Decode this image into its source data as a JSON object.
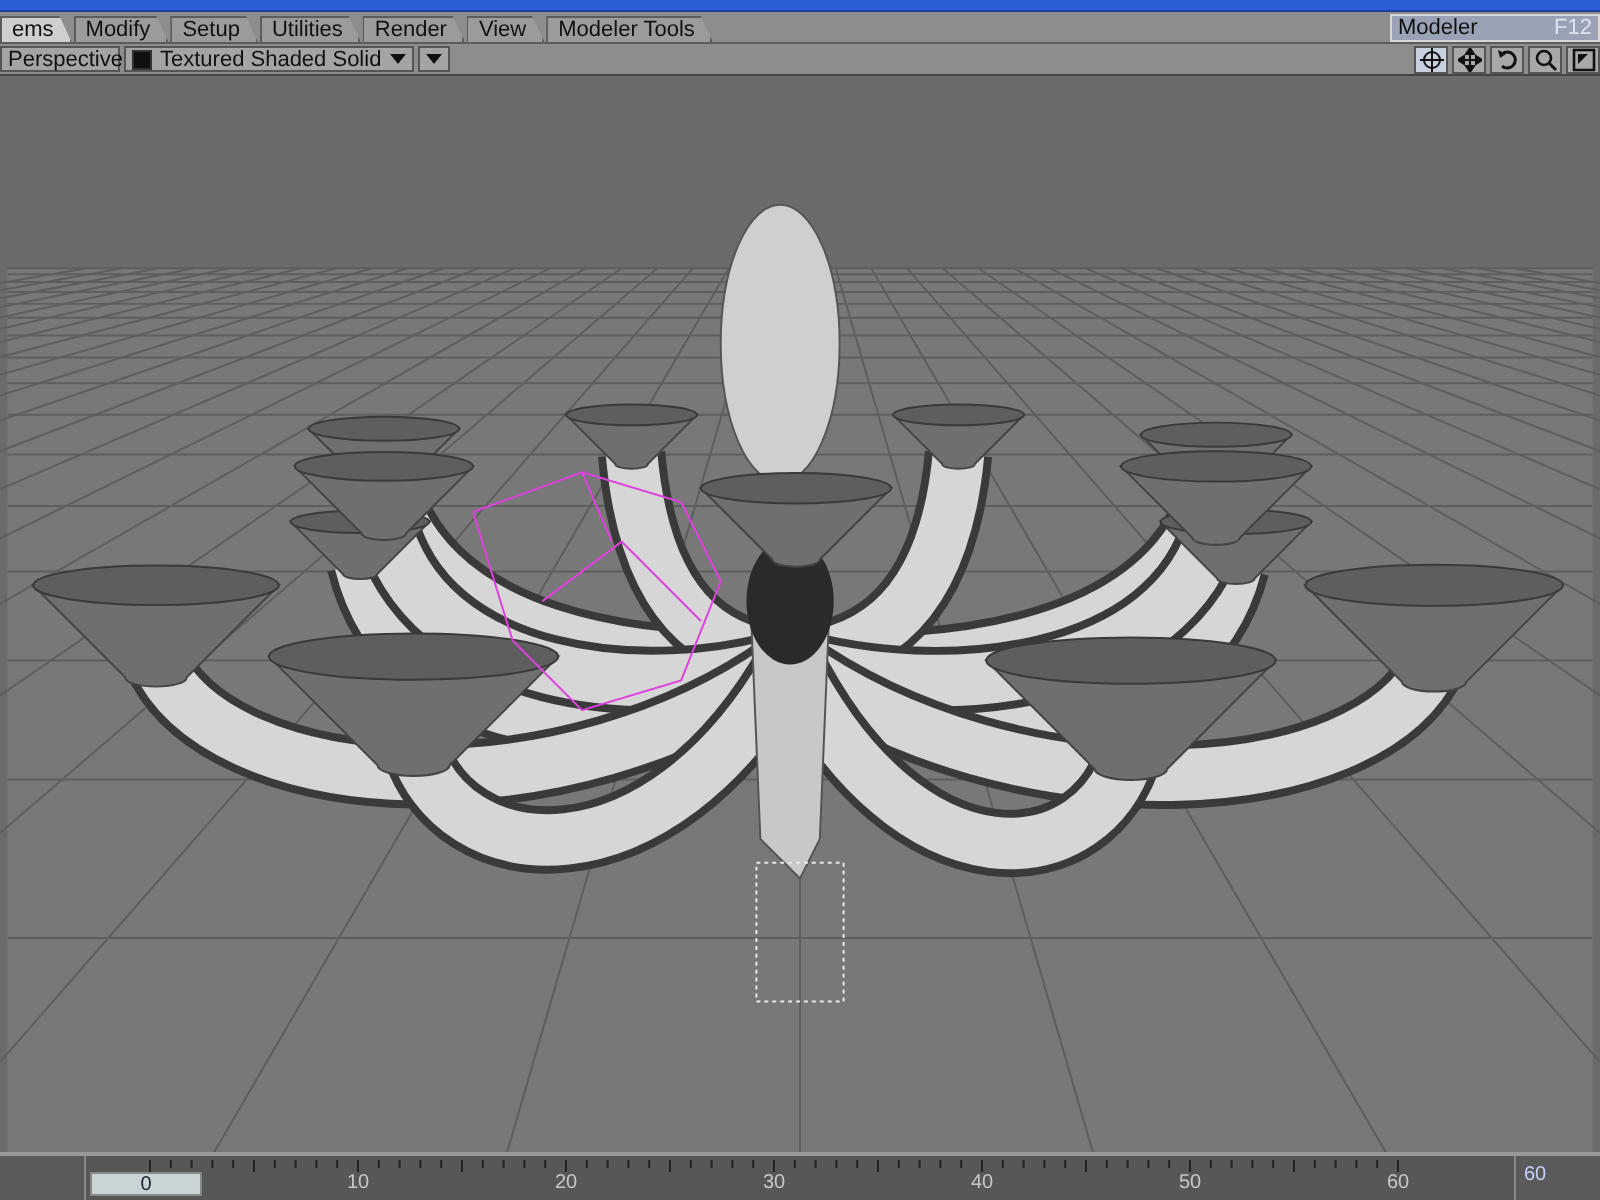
{
  "tabs": [
    {
      "label": "ems",
      "selected": true
    },
    {
      "label": "Modify",
      "selected": false
    },
    {
      "label": "Setup",
      "selected": false
    },
    {
      "label": "Utilities",
      "selected": false
    },
    {
      "label": "Render",
      "selected": false
    },
    {
      "label": "View",
      "selected": false
    },
    {
      "label": "Modeler Tools",
      "selected": false
    }
  ],
  "modeler_button": {
    "label": "Modeler",
    "shortcut": "F12"
  },
  "viewport_header": {
    "view_mode": "Perspective",
    "render_mode": "Textured Shaded Solid"
  },
  "timeline": {
    "current_frame": "0",
    "tick_labels": [
      "10",
      "20",
      "30",
      "40",
      "50",
      "60"
    ],
    "end_frame": "60"
  }
}
